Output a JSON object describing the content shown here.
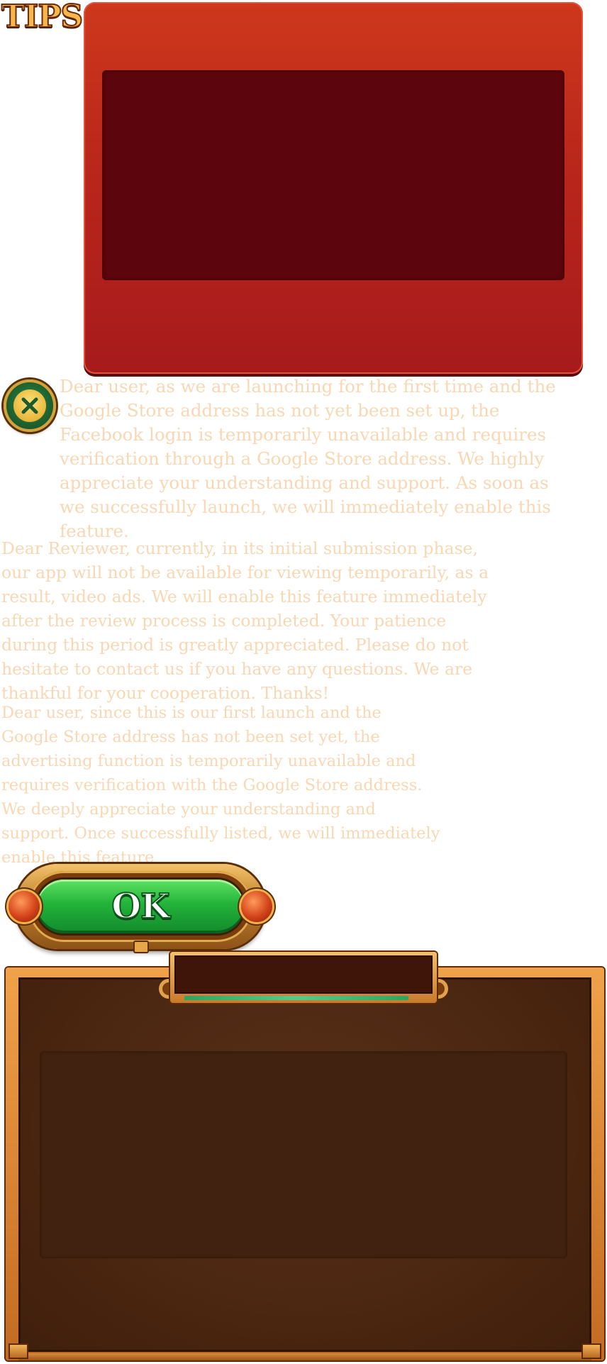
{
  "header": {
    "title": "TIPS"
  },
  "dialog": {
    "close_icon": "close-x-icon",
    "notices": [
      "Dear user, as we are launching for the first time and the Google Store address has not yet been set up, the Facebook login is temporarily unavailable and requires verification through a Google Store address. We highly appreciate your understanding and support. As soon as we successfully launch, we will immediately enable this feature.",
      "Dear Reviewer, currently, in its initial submission phase, our app will not be available for viewing temporarily, as a result, video ads. We will enable this feature immediately after the review process is completed. Your patience during this period is greatly appreciated. Please do not hesitate to contact us if you have any questions. We are thankful for your cooperation. Thanks!",
      "Dear user, since this is our first launch and the Google Store address has not been set yet, the advertising function is temporarily unavailable and requires verification with the Google Store address. We deeply appreciate your understanding and support. Once successfully listed, we will immediately enable this feature"
    ],
    "ok_label": "OK"
  },
  "colors": {
    "red_panel": "#b9261b",
    "red_panel_inner": "#5c050c",
    "notice_text": "#f9d7b2",
    "ok_green": "#23b33a",
    "brown_panel": "#48240f",
    "frame_gold": "#c26a22"
  }
}
